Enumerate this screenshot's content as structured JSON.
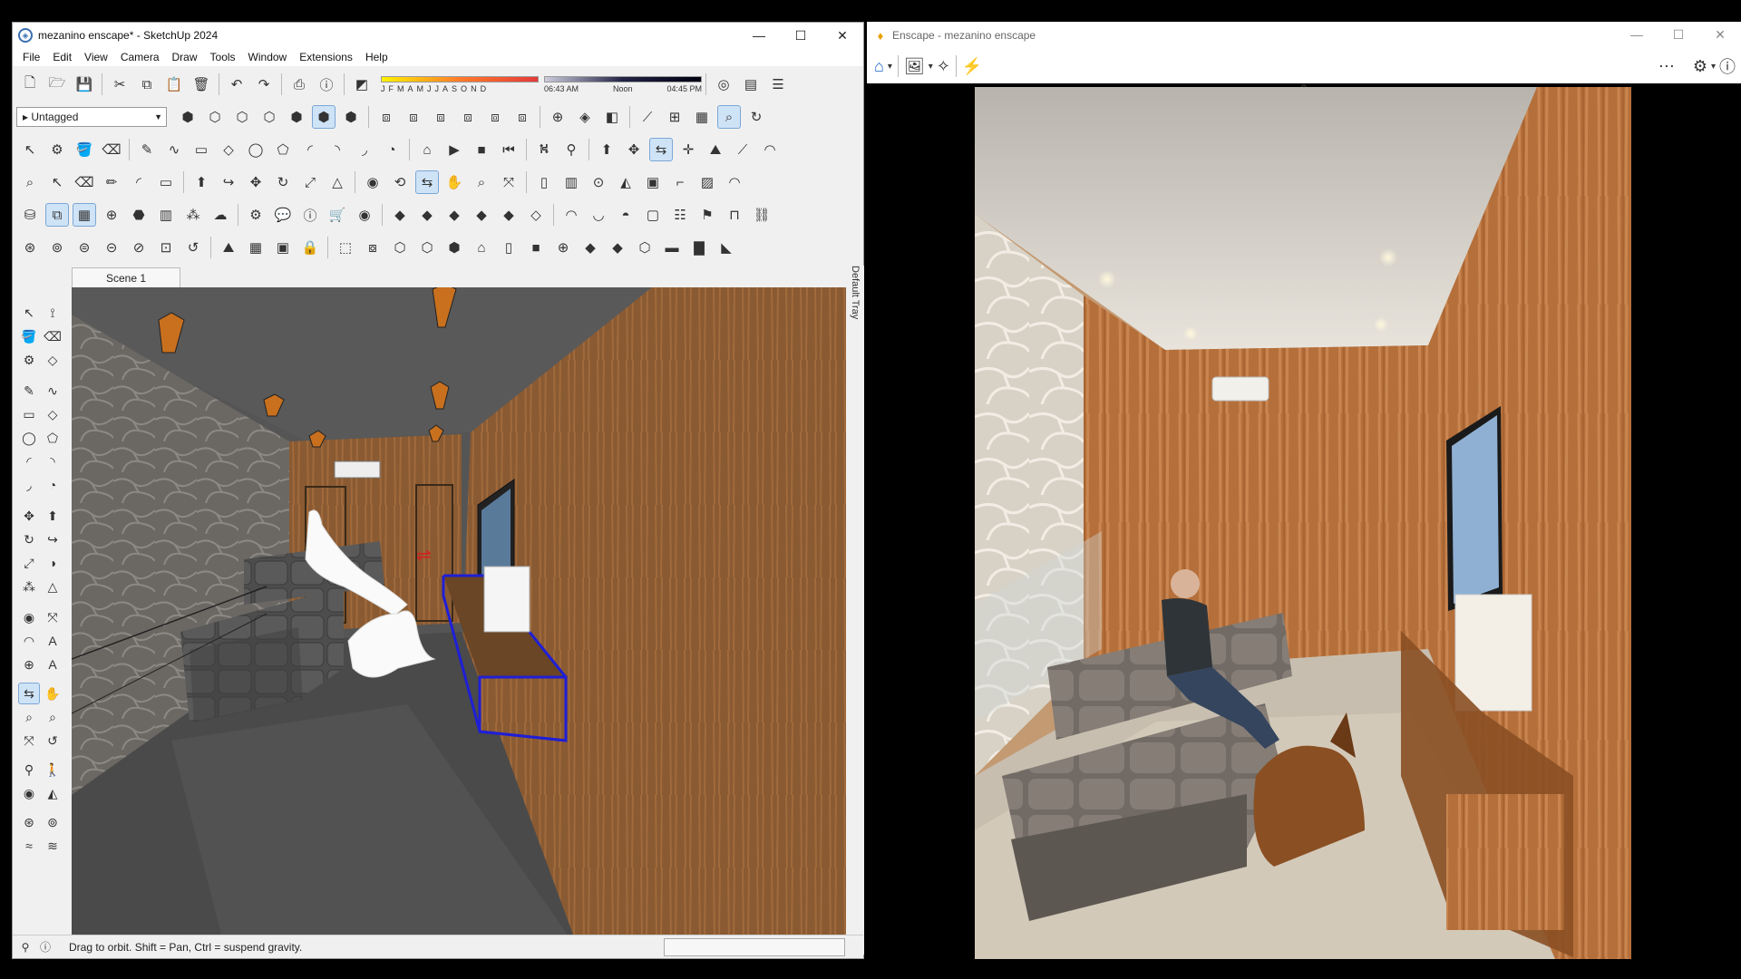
{
  "sketchup": {
    "title": "mezanino enscape* - SketchUp 2024",
    "window_controls": {
      "minimize": "—",
      "maximize": "☐",
      "close": "✕"
    },
    "menu": [
      "File",
      "Edit",
      "View",
      "Camera",
      "Draw",
      "Tools",
      "Window",
      "Extensions",
      "Help"
    ],
    "tag_selector": {
      "value": "Untagged"
    },
    "shadow_months": [
      "J",
      "F",
      "M",
      "A",
      "M",
      "J",
      "J",
      "A",
      "S",
      "O",
      "N",
      "D"
    ],
    "shadow_times": {
      "start": "06:43 AM",
      "mid": "Noon",
      "end": "04:45 PM"
    },
    "scene_tab": "Scene 1",
    "tray_label": "Default Tray",
    "status_message": "Drag to orbit. Shift = Pan, Ctrl = suspend gravity.",
    "colors": {
      "selection": "#1f1fd6",
      "wood": "#8a5a32",
      "stone": "#6d6a66"
    }
  },
  "enscape": {
    "title": "Enscape - mezanino enscape",
    "window_controls": {
      "minimize": "—",
      "maximize": "☐",
      "close": "✕"
    },
    "toolbar": {
      "home_icon": "home-icon",
      "image_icon": "image-icon",
      "wand_icon": "magic-wand-icon",
      "live_icon": "live-update-icon",
      "more_icon": "more-icon",
      "settings_icon": "settings-icon",
      "help_icon": "help-icon"
    },
    "colors": {
      "accent": "#e8a100",
      "home": "#1c66c7"
    }
  }
}
